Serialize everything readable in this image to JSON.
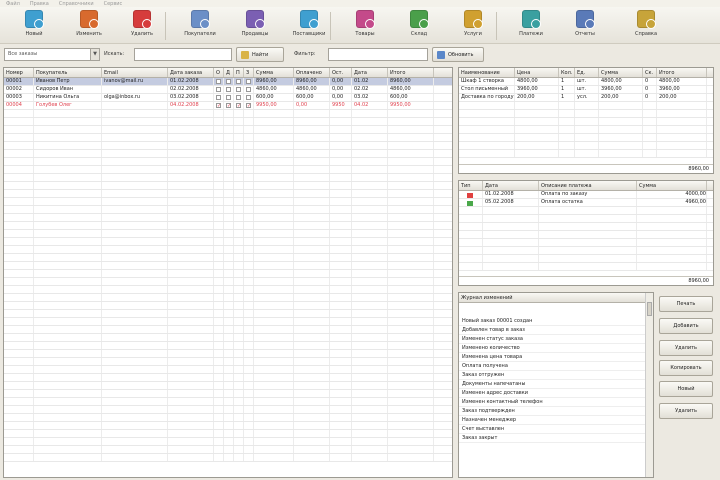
{
  "menu": [
    "Файл",
    "Правка",
    "Справочники",
    "Сервис"
  ],
  "toolbar": [
    {
      "label": "Новый",
      "color": "#3f9fd0"
    },
    {
      "label": "Изменить",
      "color": "#d86a2e"
    },
    {
      "label": "Удалить",
      "color": "#d63c3c"
    },
    {
      "label": "Покупатели",
      "color": "#6b8fc7"
    },
    {
      "label": "Продавцы",
      "color": "#7b5fb3"
    },
    {
      "label": "Поставщики",
      "color": "#3f9fd0"
    },
    {
      "label": "Товары",
      "color": "#c44a8a"
    },
    {
      "label": "Склад",
      "color": "#4a9f4a"
    },
    {
      "label": "Услуги",
      "color": "#d0a030"
    },
    {
      "label": "Платежи",
      "color": "#3aa0a0"
    },
    {
      "label": "Отчеты",
      "color": "#5a7ab8"
    },
    {
      "label": "Справка",
      "color": "#c7a43a"
    }
  ],
  "filter": {
    "combo_value": "Все заказы",
    "label1": "Искать:",
    "btn_find": "Найти",
    "label2": "Фильтр:",
    "btn_refresh": "Обновить"
  },
  "orders": {
    "columns": [
      "Номер",
      "Покупатель",
      "Email",
      "Дата заказа",
      "О",
      "Д",
      "П",
      "З",
      "Сумма",
      "Оплачено",
      "Ост.",
      "Дата",
      "Итого"
    ],
    "rows": [
      {
        "cells": [
          "00001",
          "Иванов Петр",
          "ivanov@mail.ru",
          "01.02.2008",
          "",
          "",
          "",
          "",
          "8960,00",
          "8960,00",
          "0,00",
          "01.02",
          "8960,00"
        ],
        "checks": [
          false,
          false,
          false,
          false
        ],
        "style": "sel"
      },
      {
        "cells": [
          "00002",
          "Сидоров Иван",
          "",
          "02.02.2008",
          "",
          "",
          "",
          "",
          "4860,00",
          "4860,00",
          "0,00",
          "02.02",
          "4860,00"
        ],
        "checks": [
          false,
          false,
          false,
          false
        ],
        "style": ""
      },
      {
        "cells": [
          "00003",
          "Никитина Ольга",
          "olga@inbox.ru",
          "03.02.2008",
          "",
          "",
          "",
          "",
          "600,00",
          "600,00",
          "0,00",
          "03.02",
          "600,00"
        ],
        "checks": [
          false,
          false,
          false,
          false
        ],
        "style": ""
      },
      {
        "cells": [
          "00004",
          "Голубев Олег",
          "",
          "04.02.2008",
          "",
          "",
          "",
          "",
          "9950,00",
          "0,00",
          "9950",
          "04.02",
          "9950,00"
        ],
        "checks": [
          true,
          true,
          true,
          true
        ],
        "style": "red"
      }
    ]
  },
  "items": {
    "columns": [
      "Наименование",
      "Цена",
      "Кол.",
      "Ед.",
      "Сумма",
      "Ск.",
      "Итого"
    ],
    "rows": [
      [
        "Шкаф 1 створка",
        "4800,00",
        "1",
        "шт.",
        "4800,00",
        "0",
        "4800,00"
      ],
      [
        "Стол письменный",
        "3960,00",
        "1",
        "шт.",
        "3960,00",
        "0",
        "3960,00"
      ],
      [
        "Доставка по городу",
        "200,00",
        "1",
        "усл.",
        "200,00",
        "0",
        "200,00"
      ]
    ],
    "total": "8960,00"
  },
  "payments": {
    "columns": [
      "Тип",
      "Дата",
      "Описание платежа",
      "Сумма"
    ],
    "rows": [
      {
        "date": "01.02.2008",
        "desc": "Оплата по заказу",
        "sum": "4000,00",
        "color": "#e04040"
      },
      {
        "date": "05.02.2008",
        "desc": "Оплата остатка",
        "sum": "4960,00",
        "color": "#4aa84a"
      }
    ],
    "total": "8960,00"
  },
  "notes": {
    "header": "Журнал изменений",
    "items": [
      "Новый заказ 00001 создан",
      "Добавлен товар в заказ",
      "Изменен статус заказа",
      "Изменено количество",
      "Изменена цена товара",
      "Оплата получена",
      "Заказ отгружен",
      "Документы напечатаны",
      "Изменен адрес доставки",
      "Изменен контактный телефон",
      "Заказ подтвержден",
      "Назначен менеджер",
      "Счет выставлен",
      "Заказ закрыт"
    ]
  },
  "side_buttons": [
    "Печать",
    "Добавить",
    "Удалить",
    "Копировать",
    "Новый",
    "Удалить"
  ]
}
